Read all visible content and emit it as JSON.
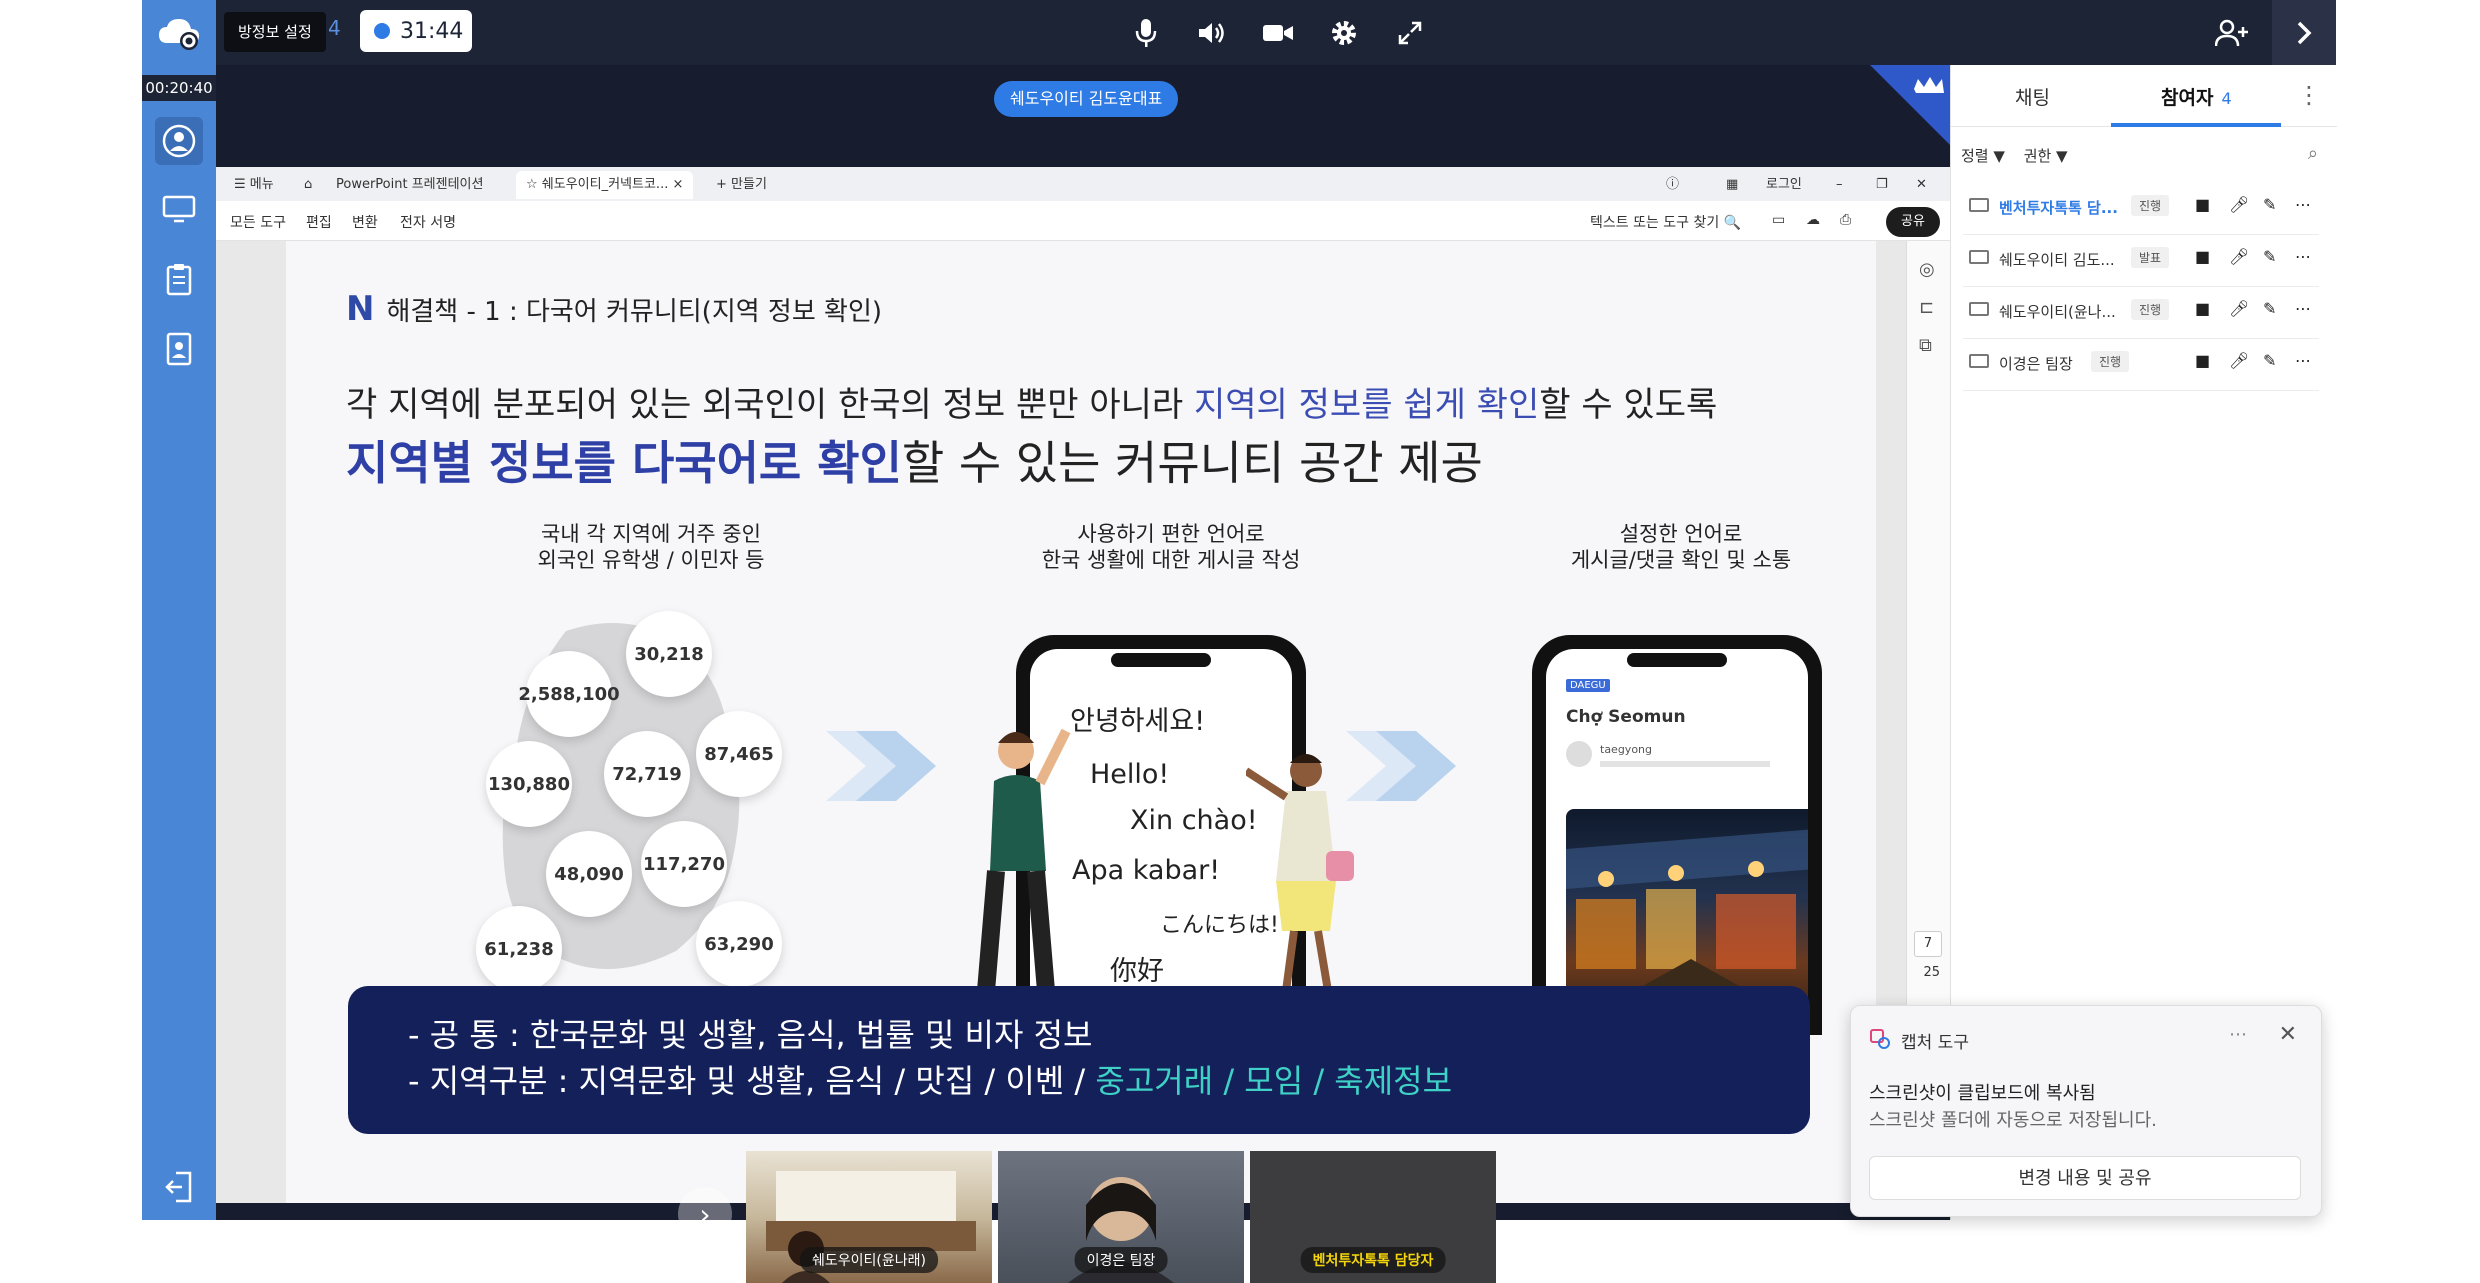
{
  "topbar": {
    "tooltip": "방정보 설정",
    "participant_count": "4",
    "timer": "31:44"
  },
  "leftnav": {
    "elapsed": "00:20:40"
  },
  "stage": {
    "presenter_pill": "쉐도우이티 김도윤대표"
  },
  "viewer": {
    "tabs": {
      "menu": "메뉴",
      "ppt": "PowerPoint 프레젠테이션",
      "doc": "쉐도우이티_커넥트코...",
      "new": "+ 만들기"
    },
    "login": "로그인",
    "tools": {
      "all": "모든 도구",
      "edit": "편집",
      "convert": "변환",
      "sign": "전자 서명",
      "search": "텍스트 또는 도구 찾기",
      "share": "공유"
    },
    "page_current": "7",
    "page_total": "25"
  },
  "slide": {
    "title": "해결책 - 1 :  다국어 커뮤니티(지역 정보 확인)",
    "headline1_a": "각 지역에 분포되어 있는 외국인이 한국의 정보 뿐만 아니라 ",
    "headline1_b": "지역의 정보를 쉽게 확인",
    "headline1_c": "할 수 있도록",
    "headline2_a": "지역별 정보를 다국어로 확인",
    "headline2_b": "할 수 있는 커뮤니티 공간 제공",
    "col1_line1": "국내 각 지역에 거주 중인",
    "col1_line2": "외국인 유학생 / 이민자 등",
    "col2_line1": "사용하기 편한 언어로",
    "col2_line2": "한국 생활에 대한 게시글 작성",
    "col3_line1": "설정한 언어로",
    "col3_line2": "게시글/댓글 확인 및 소통",
    "bubbles": [
      "30,218",
      "2,588,100",
      "87,465",
      "130,880",
      "72,719",
      "117,270",
      "48,090",
      "61,238",
      "63,290"
    ],
    "greetings": [
      "안녕하세요!",
      "Hello!",
      "Xin chào!",
      "Apa kabar!",
      "こんにちは!",
      "你好"
    ],
    "app_badge": "DAEGU",
    "app_title": "Chợ Seomun",
    "app_user": "taegyong",
    "banner_line1": "-  공       통 : 한국문화 및 생활, 음식, 법률 및 비자 정보",
    "banner_line2_a": "-  지역구분 : 지역문화 및 생활, 음식 / 맛집 / 이벤 / ",
    "banner_line2_b": "중고거래 / 모임 / 축제정보"
  },
  "videos": [
    {
      "name": "쉐도우이티(윤나래)"
    },
    {
      "name": "이경은 팀장"
    },
    {
      "name": "벤처투자톡톡 담당자"
    }
  ],
  "panel": {
    "tab_chat": "채팅",
    "tab_participants": "참여자",
    "participant_count": "4",
    "sort": "정렬 ▼",
    "permission": "권한 ▼",
    "participants": [
      {
        "name": "벤처투자톡톡 담...",
        "role": "진행"
      },
      {
        "name": "쉐도우이티 김도...",
        "role": "발표"
      },
      {
        "name": "쉐도우이티(윤나...",
        "role": "진행"
      },
      {
        "name": "이경은 팀장",
        "role": "진행"
      }
    ]
  },
  "capture": {
    "title": "캡처 도구",
    "msg1": "스크린샷이 클립보드에 복사됨",
    "msg2": "스크린샷 폴더에 자동으로 저장됩니다.",
    "button": "변경 내용 및 공유"
  },
  "colors": {
    "accent": "#2f7be5",
    "nav": "#4a86d6",
    "banner": "#14205a",
    "teal": "#3fd1c6"
  }
}
